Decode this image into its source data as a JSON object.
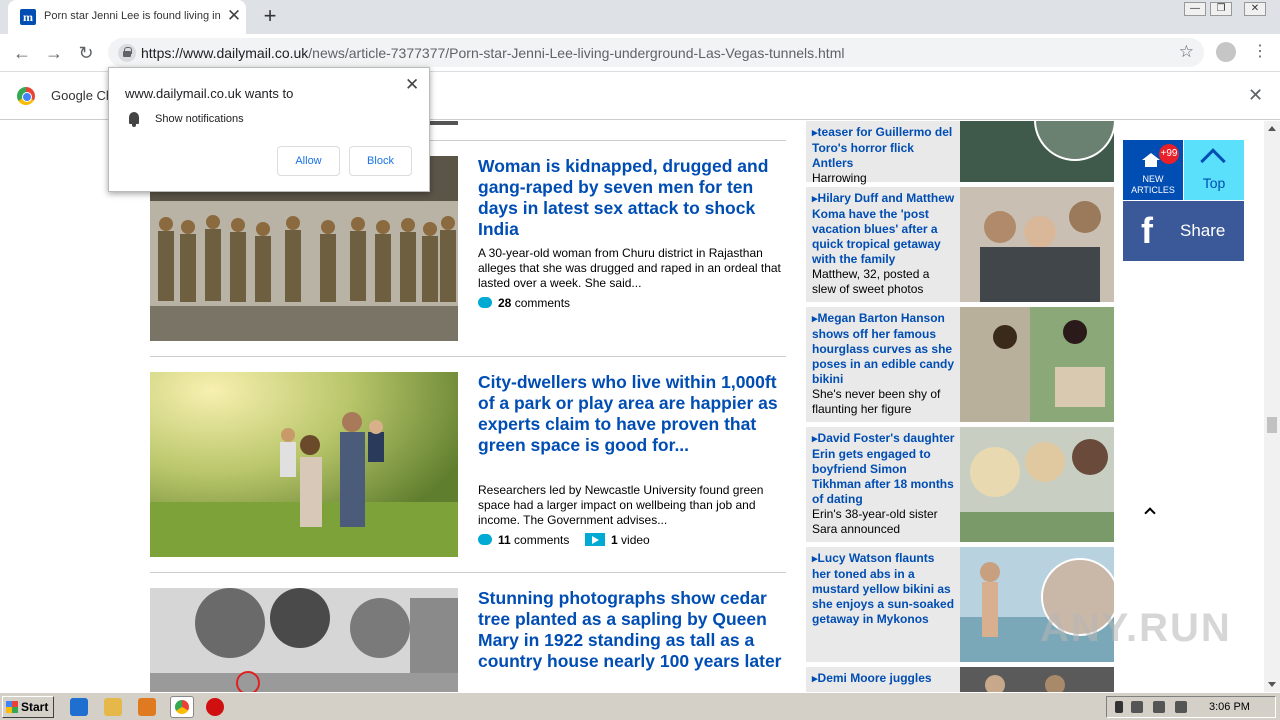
{
  "browser": {
    "tab_title": "Porn star Jenni Lee is found living in",
    "tab_favicon": "m",
    "url_domain": "https://www.dailymail.co.uk",
    "url_path": "/news/article-7377377/Porn-star-Jenni-Lee-living-underground-Las-Vegas-tunnels.html",
    "infobar_text": "Google Ch",
    "close_glyph": "✕",
    "new_tab_glyph": "+",
    "back_glyph": "←",
    "forward_glyph": "→",
    "reload_glyph": "↻",
    "star_glyph": "☆",
    "kebab_glyph": "⋮",
    "win_min": "—",
    "win_max": "❐",
    "win_close": "✕"
  },
  "notification_popup": {
    "title": "www.dailymail.co.uk wants to",
    "permission": "Show notifications",
    "allow_label": "Allow",
    "block_label": "Block"
  },
  "articles": [
    {
      "headline": "Woman is kidnapped, drugged and gang-raped by seven men for ten days in latest sex attack to shock India",
      "summary": "A 30-year-old woman from Churu district in Rajasthan alleges that she was drugged and raped in an ordeal that lasted over a week. She said...",
      "comments_count": "28",
      "comments_label": "comments"
    },
    {
      "headline": "City-dwellers who live within 1,000ft of a park or play area are happier as experts claim to have proven that green space is good for...",
      "summary": "Researchers led by Newcastle University found green space had a larger impact on wellbeing than job and income. The Government advises...",
      "comments_count": "11",
      "comments_label": "comments",
      "video_count": "1",
      "video_label": "video"
    },
    {
      "headline": "Stunning photographs show cedar tree planted as a sapling by Queen Mary in 1922 standing as tall as a country house nearly 100 years later"
    }
  ],
  "sidebar": [
    {
      "title": "teaser for Guillermo del Toro's horror flick Antlers",
      "sub": "Harrowing"
    },
    {
      "title": "Hilary Duff and Matthew Koma have the 'post vacation blues' after a quick tropical getaway with the family",
      "sub": "Matthew, 32, posted a slew of sweet photos"
    },
    {
      "title": "Megan Barton Hanson shows off her famous hourglass curves as she poses in an edible candy bikini",
      "sub": "She's never been shy of flaunting her figure"
    },
    {
      "title": "David Foster's daughter Erin gets engaged to boyfriend Simon Tikhman after 18 months of dating",
      "sub": "Erin's 38-year-old sister Sara announced"
    },
    {
      "title": "Lucy Watson flaunts her toned abs in a mustard yellow bikini as she enjoys a sun-soaked getaway in Mykonos",
      "sub": ""
    },
    {
      "title": "Demi Moore juggles",
      "sub": ""
    }
  ],
  "floaters": {
    "new_badge": "+99",
    "new_label": "NEW ARTICLES",
    "top_label": "Top",
    "share_label": "Share",
    "fb_glyph": "f"
  },
  "taskbar": {
    "start_label": "Start",
    "clock": "3:06 PM"
  },
  "watermark": "ANY.RUN",
  "colors": {
    "headline": "#004db3",
    "comment_icon": "#00aad2",
    "facebook": "#3b5998",
    "top_button": "#5ae0fa",
    "badge": "#e8202a"
  }
}
